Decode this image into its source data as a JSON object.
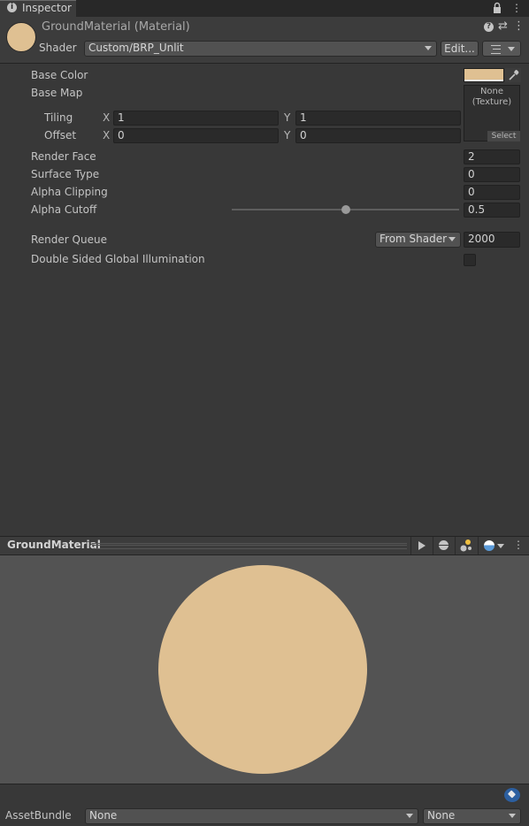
{
  "window": {
    "tab_title": "Inspector"
  },
  "header": {
    "material_name": "GroundMaterial (Material)",
    "shader_label": "Shader",
    "shader_value": "Custom/BRP_Unlit",
    "edit_label": "Edit..."
  },
  "properties": {
    "base_color": {
      "label": "Base Color",
      "color": "#dfc092"
    },
    "base_map": {
      "label": "Base Map",
      "texture_none": "None\n(Texture)",
      "select_label": "Select",
      "tiling_label": "Tiling",
      "offset_label": "Offset",
      "x_axis": "X",
      "y_axis": "Y",
      "tiling_x": "1",
      "tiling_y": "1",
      "offset_x": "0",
      "offset_y": "0"
    },
    "render_face": {
      "label": "Render Face",
      "value": "2"
    },
    "surface_type": {
      "label": "Surface Type",
      "value": "0"
    },
    "alpha_clipping": {
      "label": "Alpha Clipping",
      "value": "0"
    },
    "alpha_cutoff": {
      "label": "Alpha Cutoff",
      "value": "0.5",
      "slider_fraction": 0.5
    },
    "render_queue": {
      "label": "Render Queue",
      "mode": "From Shader",
      "value": "2000"
    },
    "double_sided_gi": {
      "label": "Double Sided Global Illumination",
      "checked": false
    }
  },
  "preview": {
    "title": "GroundMaterial",
    "sphere_color": "#dfc092"
  },
  "asset_bundle": {
    "label": "AssetBundle",
    "name_value": "None",
    "variant_value": "None"
  }
}
